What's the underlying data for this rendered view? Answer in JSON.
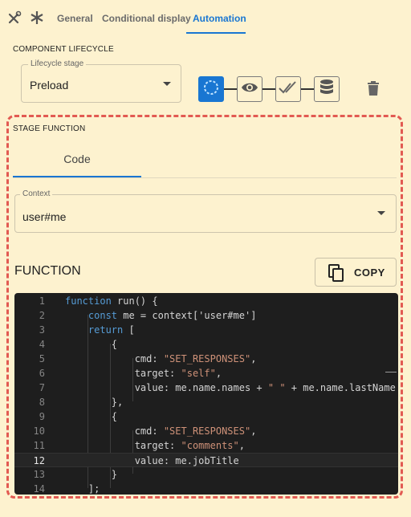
{
  "header": {
    "tabs": [
      {
        "label": "General"
      },
      {
        "label": "Conditional display"
      },
      {
        "label": "Automation",
        "active": true
      }
    ]
  },
  "lifecycle": {
    "section_title": "COMPONENT LIFECYCLE",
    "stage_legend": "Lifecycle stage",
    "stage_value": "Preload",
    "stages": [
      {
        "icon": "circle-dashed-icon",
        "active": true
      },
      {
        "icon": "eye-icon",
        "active": false
      },
      {
        "icon": "double-check-icon",
        "active": false
      },
      {
        "icon": "database-icon",
        "active": false
      }
    ],
    "delete_icon": "trash-icon"
  },
  "stage_function": {
    "section_title": "STAGE FUNCTION",
    "tab_label": "Code",
    "context_legend": "Context",
    "context_value": "user#me",
    "function_title": "FUNCTION",
    "copy_label": "COPY"
  },
  "editor": {
    "current_line": 12,
    "lines": [
      {
        "n": "1",
        "segs": [
          [
            "kw",
            "function"
          ],
          [
            "p",
            " run() {"
          ]
        ]
      },
      {
        "n": "2",
        "segs": [
          [
            "p",
            "    "
          ],
          [
            "kw",
            "const"
          ],
          [
            "p",
            " me = context['user#me']"
          ]
        ]
      },
      {
        "n": "3",
        "segs": [
          [
            "p",
            "    "
          ],
          [
            "kw",
            "return"
          ],
          [
            "p",
            " ["
          ]
        ]
      },
      {
        "n": "4",
        "segs": [
          [
            "p",
            "        {"
          ]
        ]
      },
      {
        "n": "5",
        "segs": [
          [
            "p",
            "            cmd: "
          ],
          [
            "str",
            "\"SET_RESPONSES\""
          ],
          [
            "p",
            ","
          ]
        ]
      },
      {
        "n": "6",
        "segs": [
          [
            "p",
            "            target: "
          ],
          [
            "str",
            "\"self\""
          ],
          [
            "p",
            ","
          ]
        ]
      },
      {
        "n": "7",
        "segs": [
          [
            "p",
            "            value: me.name.names + "
          ],
          [
            "str",
            "\" \""
          ],
          [
            "p",
            " + me.name.lastName"
          ]
        ]
      },
      {
        "n": "8",
        "segs": [
          [
            "p",
            "        },"
          ]
        ]
      },
      {
        "n": "9",
        "segs": [
          [
            "p",
            "        {"
          ]
        ]
      },
      {
        "n": "10",
        "segs": [
          [
            "p",
            "            cmd: "
          ],
          [
            "str",
            "\"SET_RESPONSES\""
          ],
          [
            "p",
            ","
          ]
        ]
      },
      {
        "n": "11",
        "segs": [
          [
            "p",
            "            target: "
          ],
          [
            "str",
            "\"comments\""
          ],
          [
            "p",
            ","
          ]
        ]
      },
      {
        "n": "12",
        "segs": [
          [
            "p",
            "            value: me.jobTitle"
          ]
        ]
      },
      {
        "n": "13",
        "segs": [
          [
            "p",
            "        }"
          ]
        ]
      },
      {
        "n": "14",
        "segs": [
          [
            "p",
            "    ];"
          ]
        ]
      }
    ]
  },
  "colors": {
    "background": "#fdf2cf",
    "accent": "#1976d2",
    "highlight_border": "#e25a52",
    "editor_bg": "#1e1e1e",
    "keyword": "#569cd6",
    "string": "#ce9178"
  }
}
